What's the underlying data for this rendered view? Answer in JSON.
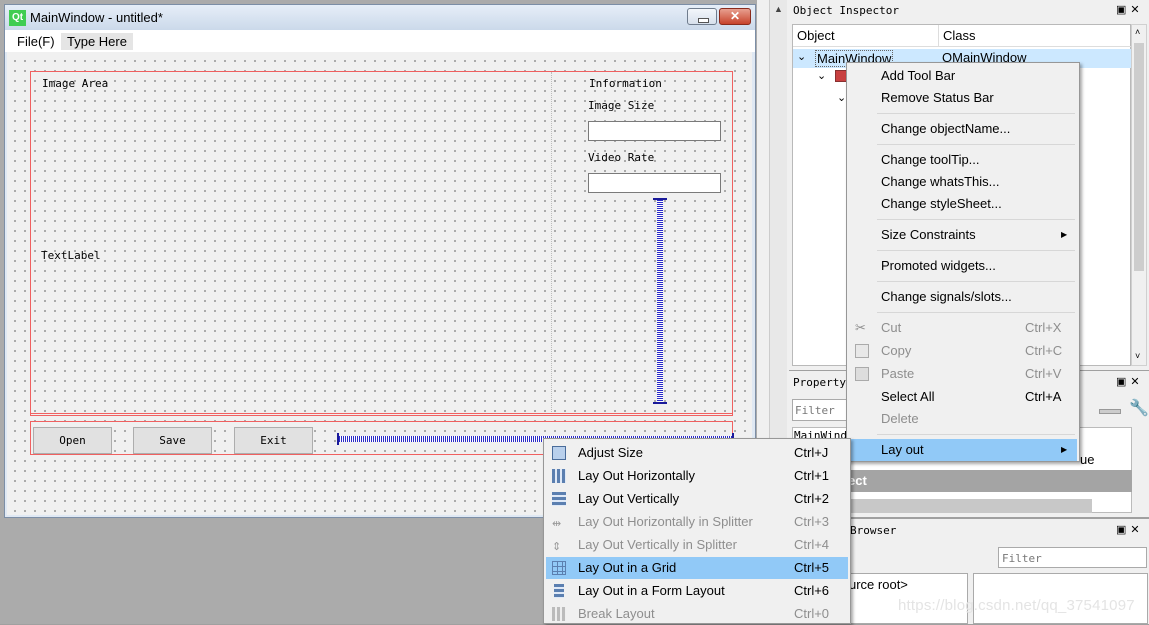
{
  "window": {
    "title": "MainWindow - untitled*",
    "menu": [
      "File(F)",
      "Type Here"
    ]
  },
  "form": {
    "image_area_label": "Image Area",
    "text_label": "TextLabel",
    "info_title": "Information",
    "image_size_label": "Image Size",
    "video_rate_label": "Video Rate",
    "buttons": [
      "Open",
      "Save",
      "Exit"
    ]
  },
  "object_inspector": {
    "title": "Object Inspector",
    "col_object": "Object",
    "col_class": "Class",
    "row_object": "MainWindow",
    "row_class": "QMainWindow"
  },
  "property_editor": {
    "title": "Property",
    "filter_placeholder": "Filter",
    "object_prefix": "MainWindo",
    "value_fragment": "ue",
    "section_fragment": "ect"
  },
  "resource_browser": {
    "title_fragment": "Browser",
    "filter_placeholder": "Filter",
    "root_fragment": "urce root>"
  },
  "context_menu": {
    "items": [
      {
        "label": "Add Tool Bar"
      },
      {
        "label": "Remove Status Bar"
      },
      {
        "label": "Change objectName..."
      },
      {
        "label": "Change toolTip..."
      },
      {
        "label": "Change whatsThis..."
      },
      {
        "label": "Change styleSheet..."
      },
      {
        "label": "Size Constraints",
        "submenu": true
      },
      {
        "label": "Promoted widgets..."
      },
      {
        "label": "Change signals/slots..."
      },
      {
        "label": "Cut",
        "shortcut": "Ctrl+X",
        "disabled": true
      },
      {
        "label": "Copy",
        "shortcut": "Ctrl+C",
        "disabled": true
      },
      {
        "label": "Paste",
        "shortcut": "Ctrl+V",
        "disabled": true
      },
      {
        "label": "Select All",
        "shortcut": "Ctrl+A"
      },
      {
        "label": "Delete",
        "disabled": true
      },
      {
        "label": "Lay out",
        "submenu": true,
        "highlighted": true
      }
    ]
  },
  "layout_menu": {
    "items": [
      {
        "label": "Adjust Size",
        "shortcut": "Ctrl+J"
      },
      {
        "label": "Lay Out Horizontally",
        "shortcut": "Ctrl+1"
      },
      {
        "label": "Lay Out Vertically",
        "shortcut": "Ctrl+2"
      },
      {
        "label": "Lay Out Horizontally in Splitter",
        "shortcut": "Ctrl+3",
        "disabled": true
      },
      {
        "label": "Lay Out Vertically in Splitter",
        "shortcut": "Ctrl+4",
        "disabled": true
      },
      {
        "label": "Lay Out in a Grid",
        "shortcut": "Ctrl+5",
        "highlighted": true
      },
      {
        "label": "Lay Out in a Form Layout",
        "shortcut": "Ctrl+6"
      },
      {
        "label": "Break Layout",
        "shortcut": "Ctrl+0",
        "disabled": true
      }
    ]
  },
  "watermark": "https://blog.csdn.net/qq_37541097",
  "colors": {
    "highlight": "#91c9f7",
    "layout_frame": "#f06060",
    "spacer": "#2a2ac8"
  }
}
